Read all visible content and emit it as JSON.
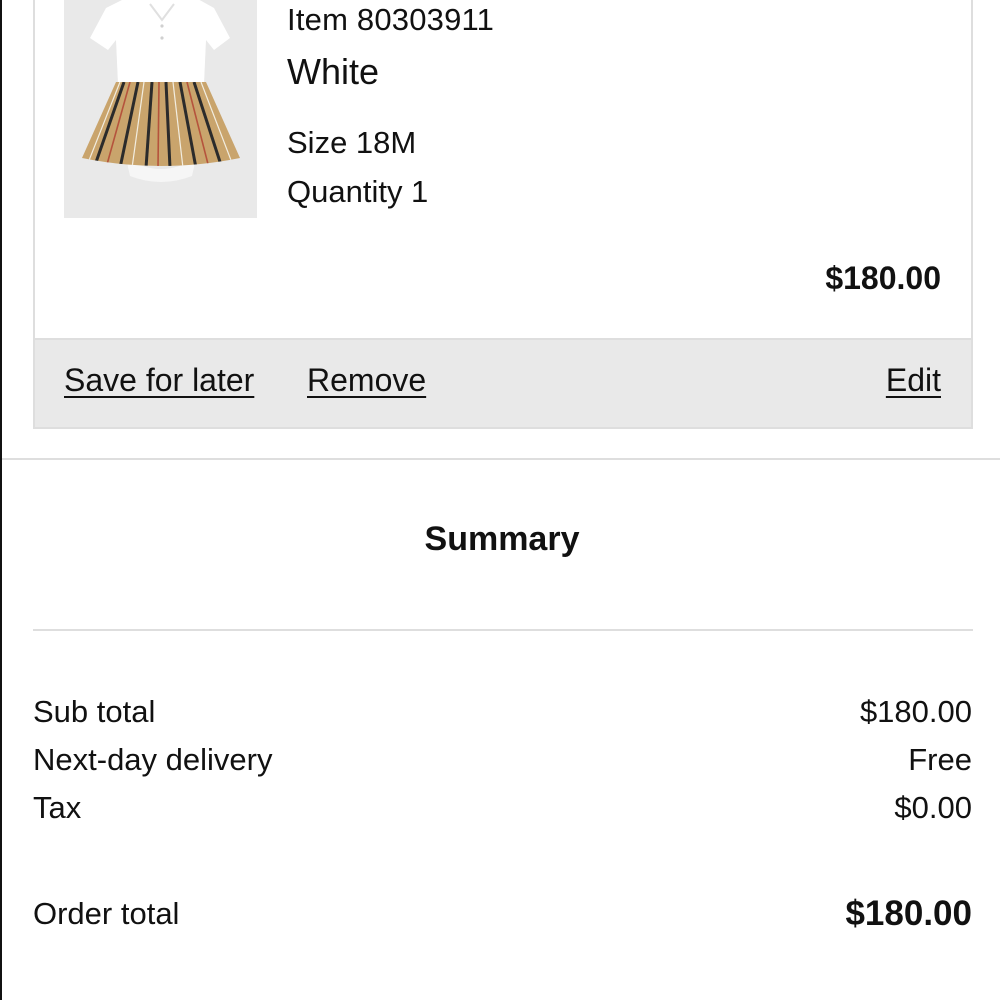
{
  "cart_item": {
    "item_number": "Item 80303911",
    "color": "White",
    "size": "Size 18M",
    "quantity": "Quantity 1",
    "price": "$180.00",
    "actions": {
      "save_for_later": "Save for later",
      "remove": "Remove",
      "edit": "Edit"
    },
    "image_icon": "product-dress-image"
  },
  "summary": {
    "title": "Summary",
    "rows": [
      {
        "label": "Sub total",
        "value": "$180.00"
      },
      {
        "label": "Next-day delivery",
        "value": "Free"
      },
      {
        "label": "Tax",
        "value": "$0.00"
      }
    ],
    "order_total": {
      "label": "Order total",
      "value": "$180.00"
    }
  },
  "colors": {
    "text": "#111111",
    "border": "#dedede",
    "action_bar_bg": "#e9e9e9",
    "image_bg": "#e9e9e9",
    "stripe_camel": "#c9a46c",
    "stripe_black": "#2b2b2b",
    "stripe_red": "#b5533c"
  }
}
